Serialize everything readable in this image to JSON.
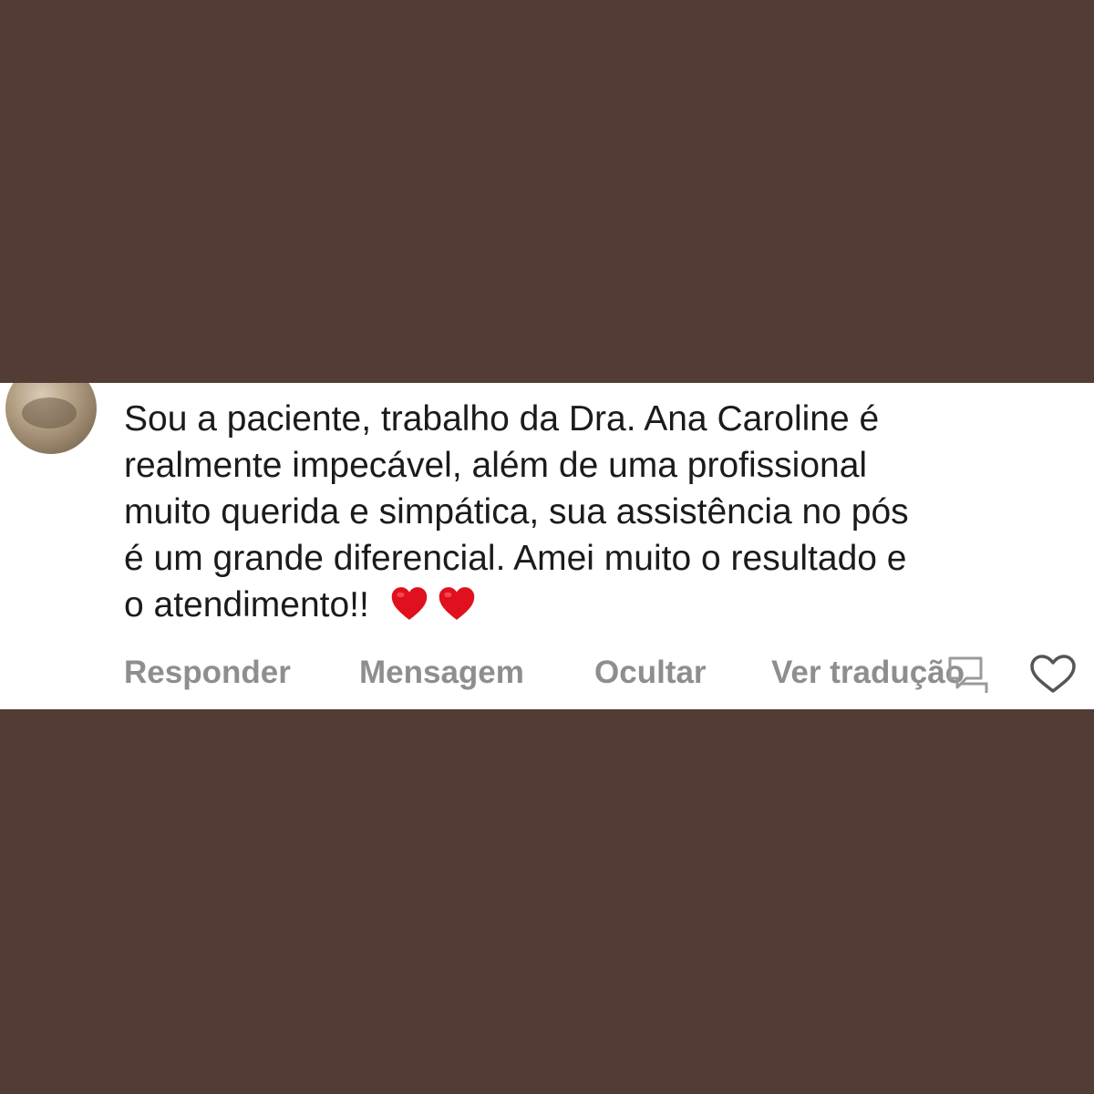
{
  "comment": {
    "text": "Sou a paciente, trabalho da Dra. Ana Caroline é\nrealmente impecável, além de uma profissional\nmuito querida e simpática, sua assistência no pós\né um grande diferencial. Amei muito o resultado e\no atendimento!!",
    "emoji": [
      "red-heart",
      "red-heart"
    ]
  },
  "actions": {
    "reply": "Responder",
    "message": "Mensagem",
    "hide": "Ocultar",
    "translate": "Ver tradução"
  },
  "colors": {
    "background": "#533c35",
    "card": "#ffffff",
    "text": "#1b1b1b",
    "action_text": "#8e8e8e",
    "heart": "#e0101e"
  },
  "icons": {
    "like": "heart-outline-icon",
    "avatar": "profile-avatar"
  }
}
